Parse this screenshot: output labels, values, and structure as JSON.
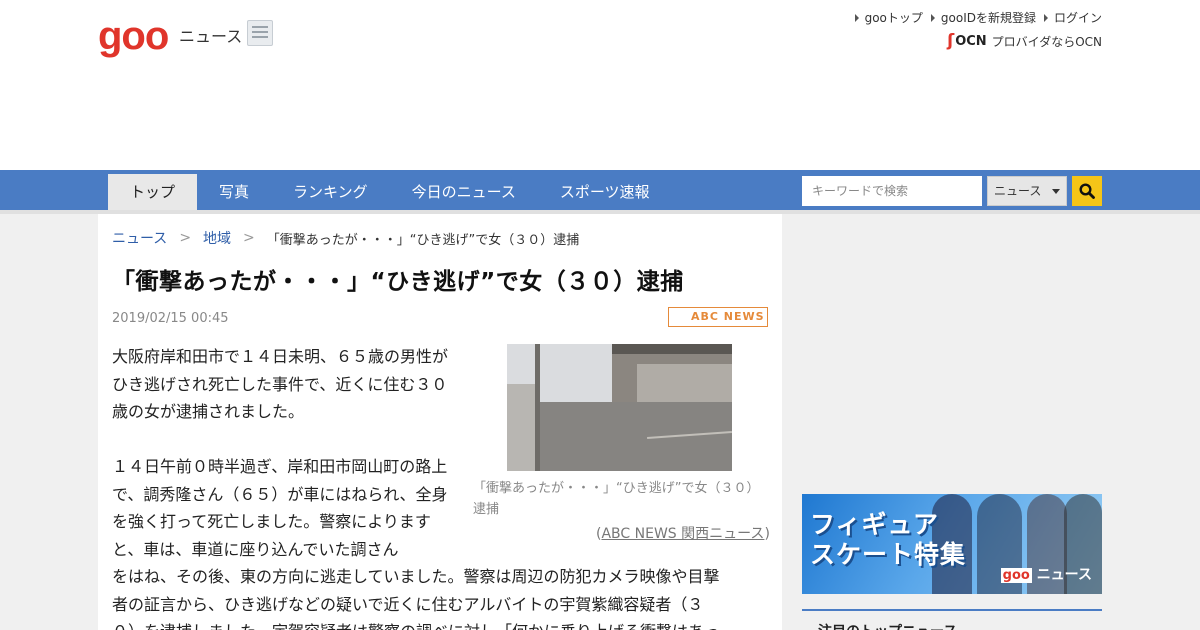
{
  "header": {
    "logo": "goo",
    "section": "ニュース",
    "links": [
      "gooトップ",
      "gooIDを新規登録",
      "ログイン"
    ],
    "ocn_logo": "OCN",
    "ocn_text": "プロバイダならOCN"
  },
  "nav": {
    "tabs": [
      "トップ",
      "写真",
      "ランキング",
      "今日のニュース",
      "スポーツ速報"
    ],
    "active_tab": "トップ"
  },
  "search": {
    "placeholder": "キーワードで検索",
    "selected_category": "ニュース"
  },
  "breadcrumb": {
    "items": [
      "ニュース",
      "地域"
    ],
    "current": "「衝撃あったが・・・」“ひき逃げ”で女（３０）逮捕"
  },
  "article": {
    "title": "「衝撃あったが・・・」“ひき逃げ”で女（３０）逮捕",
    "date": "2019/02/15 00:45",
    "source_logo": "ABC NEWS",
    "para1": "大阪府岸和田市で１４日未明、６５歳の男性がひき逃げされ死亡した事件で、近くに住む３０歳の女が逮捕されました。",
    "para2": "１４日午前０時半過ぎ、岸和田市岡山町の路上で、調秀隆さん（６５）が車にはねられ、全身を強く打って死亡しました。警察によりますと、車は、車道に座り込んでいた調さん",
    "para2_cont1": "をはね、その後、東の方向に逃走していました。警察は周辺の防犯カメラ映像や目撃",
    "para2_cont2": "者の証言から、ひき逃げなどの疑いで近くに住むアルバイトの宇賀紫織容疑者（３",
    "para2_cont3": "０）を逮捕しました。宇賀容疑者は警察の調べに対し「何かに乗り上げる衝撃はあっ",
    "caption": "「衝撃あったが・・・」“ひき逃げ”で女（３０）逮捕",
    "credit": "ABC NEWS 関西ニュース"
  },
  "sidebar": {
    "ad_title_line1": "フィギュア",
    "ad_title_line2": "スケート特集",
    "ad_brand_logo": "goo",
    "ad_brand_text": "ニュース",
    "heading": "注目のトップニュース"
  },
  "colors": {
    "brand_red": "#e0352b",
    "nav_blue": "#4a7cc4",
    "search_button": "#f5c518",
    "link_blue": "#2f5ea8"
  }
}
